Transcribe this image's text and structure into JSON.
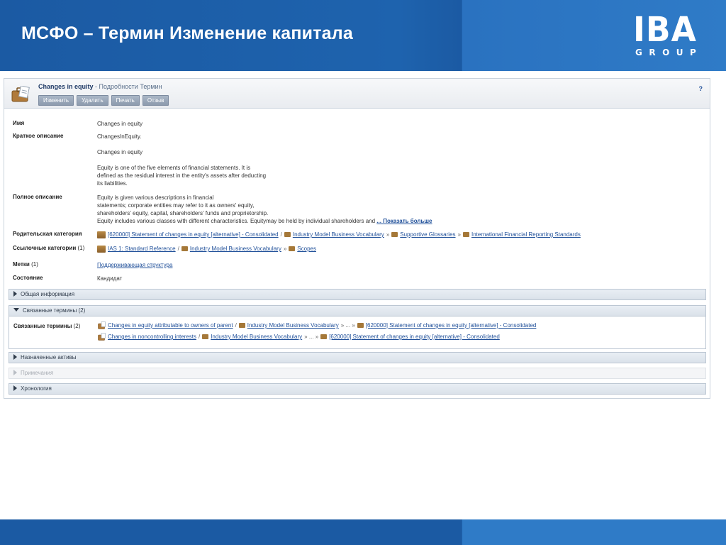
{
  "slide": {
    "title": "МСФО – Термин Изменение капитала",
    "logo": {
      "main": "IBA",
      "sub": "GROUP"
    },
    "colors": {
      "header": "#1b5aa3",
      "header_right": "#2f7bc7",
      "link": "#1f4f99"
    }
  },
  "toolbar": {
    "term_name": "Changes in equity",
    "subtitle": " - Подробности Термин",
    "buttons": [
      "Изменить",
      "Удалить",
      "Печать",
      "Отзыв"
    ],
    "help": "?"
  },
  "properties": {
    "name": {
      "label": "Имя",
      "value": "Changes in equity"
    },
    "short_description": {
      "label": "Краткое описание",
      "lines": [
        "ChangesInEquity.",
        "",
        "Changes in equity",
        "",
        "Equity is one of the five elements of financial statements. It is",
        "defined as the residual interest in the entity's assets after deducting",
        "its liabilities."
      ]
    },
    "full_description": {
      "label": "Полное описание",
      "lines": [
        "Equity is given various descriptions in financial",
        "statements; corporate entities may refer to it as owners' equity,",
        "shareholders' equity, capital, shareholders' funds and proprietorship.",
        "Equity includes various classes with different characteristics. Equitymay be held by individual shareholders and"
      ],
      "more": "... Показать больше"
    },
    "parent_category": {
      "label": "Родительская категория",
      "path": [
        "[620000] Statement of changes in equity [alternative] - Consolidated",
        "Industry Model Business Vocabulary",
        "Supportive Glossaries",
        "International Financial Reporting Standards"
      ],
      "separators": [
        "/",
        "»",
        "»"
      ]
    },
    "reference_categories": {
      "label": "Ссылочные категории",
      "count": "(1)",
      "path": [
        "IAS 1: Standard Reference",
        "Industry Model Business Vocabulary",
        "Scopes"
      ],
      "separators": [
        "/",
        "»"
      ]
    },
    "labels": {
      "label": "Метки",
      "count": "(1)",
      "value": "Поддерживающая структура"
    },
    "status": {
      "label": "Состояние",
      "value": "Кандидат"
    }
  },
  "sections": {
    "general_info": "Общая информация",
    "related_terms": "Связанные термины (2)",
    "assigned_assets": "Назначенные активы",
    "notes": "Примечания",
    "history": "Хронология"
  },
  "related_terms": {
    "label": "Связанные термины",
    "count": "(2)",
    "items": [
      {
        "term": "Changes in equity attributable to owners of parent",
        "sep1": "/",
        "cat1": "Industry Model Business Vocabulary",
        "mid": "» ... »",
        "cat2": "[620000] Statement of changes in equity [alternative] - Consolidated"
      },
      {
        "term": "Changes in noncontrolling interests",
        "sep1": "/",
        "cat1": "Industry Model Business Vocabulary",
        "mid": "» ... »",
        "cat2": "[620000] Statement of changes in equity [alternative] - Consolidated"
      }
    ]
  }
}
